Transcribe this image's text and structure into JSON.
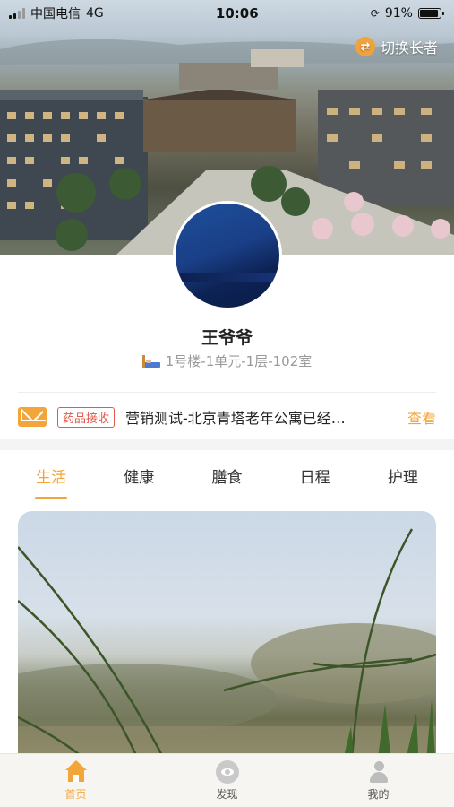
{
  "status_bar": {
    "carrier": "中国电信",
    "network": "4G",
    "time": "10:06",
    "battery_text": "91%",
    "battery_level": 0.91
  },
  "header": {
    "switch_label": "切换长者",
    "switch_icon": "swap-arrows-icon"
  },
  "profile": {
    "name": "王爷爷",
    "room": "1号楼-1单元-1层-102室",
    "room_icon": "bed-icon"
  },
  "notice": {
    "icon": "mail-icon",
    "tag": "药品接收",
    "text": "营销测试-北京青塔老年公寓已经…",
    "action": "查看"
  },
  "tabs": [
    {
      "label": "生活",
      "active": true
    },
    {
      "label": "健康",
      "active": false
    },
    {
      "label": "膳食",
      "active": false
    },
    {
      "label": "日程",
      "active": false
    },
    {
      "label": "护理",
      "active": false
    }
  ],
  "tabbar": [
    {
      "label": "首页",
      "icon": "home-icon",
      "active": true
    },
    {
      "label": "发现",
      "icon": "discover-icon",
      "active": false
    },
    {
      "label": "我的",
      "icon": "user-icon",
      "active": false
    }
  ],
  "colors": {
    "accent": "#f2a63a",
    "tag_red": "#e05a4e",
    "muted_text": "#999999"
  }
}
